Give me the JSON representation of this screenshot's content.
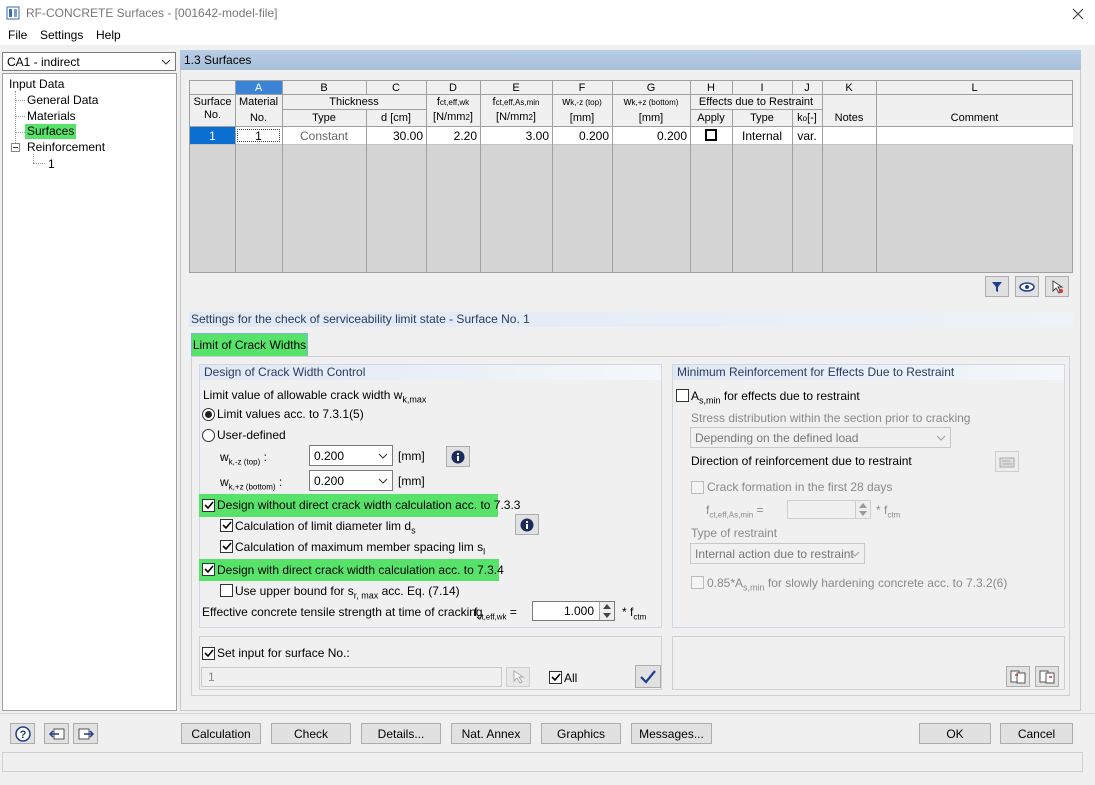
{
  "window": {
    "title": "RF-CONCRETE Surfaces - [001642-model-file]"
  },
  "menu": [
    "File",
    "Settings",
    "Help"
  ],
  "case_select": "CA1 - indirect",
  "tree": {
    "root": "Input Data",
    "items": [
      "General Data",
      "Materials",
      "Surfaces"
    ],
    "reinforcement": "Reinforcement",
    "reinf_child": "1"
  },
  "section_title": "1.3 Surfaces",
  "table": {
    "col_letters": [
      "A",
      "B",
      "C",
      "D",
      "E",
      "F",
      "G",
      "H",
      "I",
      "J",
      "K",
      "L"
    ],
    "row_header": {
      "top": "Surface",
      "bottom": "No."
    },
    "material": {
      "top": "Material",
      "bottom": "No."
    },
    "thickness": {
      "group": "Thickness",
      "type": "Type",
      "d": "d [cm]"
    },
    "fct": {
      "top": "f",
      "sub": "ct,eff,wk",
      "unit": "[N/mm",
      "sup": "2",
      "close": "]"
    },
    "fctas": {
      "top": "f",
      "sub": "ct,eff,As,min",
      "unit": "[N/mm",
      "sup": "2",
      "close": "]"
    },
    "wtop": {
      "top": "w",
      "sub": "k,-z (top)",
      "unit": "[mm]"
    },
    "wbot": {
      "top": "w",
      "sub": "k,+z (bottom)",
      "unit": "[mm]"
    },
    "effects": {
      "group": "Effects due to Restraint",
      "apply": "Apply",
      "type": "Type"
    },
    "k0": {
      "top": "k",
      "sub": "o",
      "tail": " [-]"
    },
    "notes": "Notes",
    "comment": "Comment",
    "rows": [
      {
        "no": "1",
        "material": "1",
        "type": "Constant",
        "d": "30.00",
        "fct": "2.20",
        "fctas": "3.00",
        "wtop": "0.200",
        "wbot": "0.200",
        "apply": false,
        "etype": "Internal",
        "k0": "var.",
        "notes": "",
        "comment": ""
      }
    ]
  },
  "settings_title": "Settings for the check of serviceability limit state - Surface No. 1",
  "tab": "Limit of Crack Widths",
  "design": {
    "title": "Design of Crack Width Control",
    "limit_label": "Limit value of allowable crack width w",
    "limit_sub": "k,max",
    "radio1": "Limit values acc. to 7.3.1(5)",
    "radio2": "User-defined",
    "wtop_label": "w",
    "wtop_sub": "k,-z (top)",
    "wtop_colon": ":",
    "wtop_value": "0.200",
    "wtop_unit": "[mm]",
    "wbot_label": "w",
    "wbot_sub": "k,+z (bottom)",
    "wbot_colon": ":",
    "wbot_value": "0.200",
    "wbot_unit": "[mm]",
    "cb1": "Design without direct crack width calculation acc. to 7.3.3",
    "cb1a": "Calculation of limit diameter lim d",
    "cb1a_sub": "s",
    "cb1b": "Calculation of maximum member spacing lim s",
    "cb1b_sub": "l",
    "cb2": "Design with direct crack width calculation acc. to 7.3.4",
    "cb2a": "Use upper bound for s",
    "cb2a_sub": "r, max",
    "cb2a_tail": " acc. Eq. (7.14)",
    "eff_label": "Effective concrete tensile strength at time of cracking",
    "eff_sym": "f",
    "eff_sub": "ct,eff,wk",
    "eff_eq": " =",
    "eff_value": "1.000",
    "eff_unit": "* f",
    "eff_unit_sub": "ctm"
  },
  "minreinf": {
    "title": "Minimum Reinforcement for Effects Due to Restraint",
    "cb": "A",
    "cb_sub": "s,min",
    "cb_tail": " for effects due to restraint",
    "stress_label": "Stress distribution within the section prior to cracking",
    "stress_value": "Depending on the defined load",
    "direction": "Direction of reinforcement due to restraint",
    "crack28": "Crack formation in the first 28 days",
    "fct_label": "f",
    "fct_sub": "ct,eff,As,min",
    "fct_eq": " =",
    "fct_unit": "* f",
    "fct_unit_sub": "ctm",
    "restraint_label": "Type of restraint",
    "restraint_value": "Internal action due to restraint",
    "slow": "0.85*A",
    "slow_sub": "s,min",
    "slow_tail": " for slowly hardening concrete acc. to 7.3.2(6)"
  },
  "setinput": {
    "label": "Set input for surface No.:",
    "value": "1",
    "all": "All"
  },
  "buttons": {
    "calculation": "Calculation",
    "check": "Check",
    "details": "Details...",
    "natannex": "Nat. Annex",
    "graphics": "Graphics",
    "messages": "Messages...",
    "ok": "OK",
    "cancel": "Cancel"
  },
  "colors": {
    "highlight": "#57e36a",
    "selected": "#0078d7",
    "header_blue": "#dfe8f4"
  }
}
